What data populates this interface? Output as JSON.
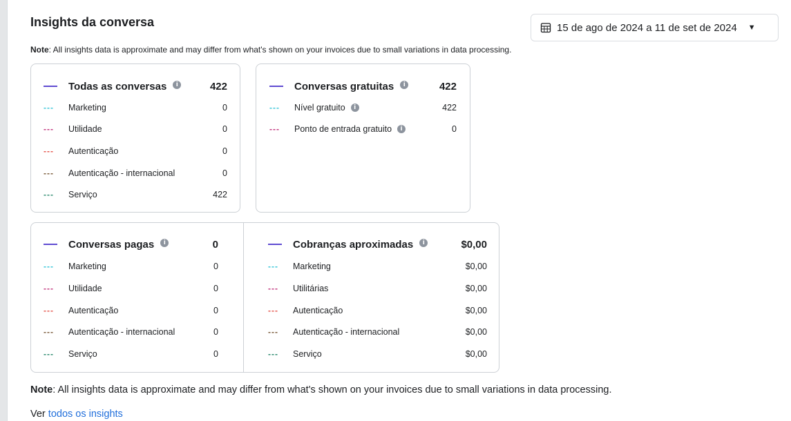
{
  "title": "Insights da conversa",
  "date_range": "15 de ago de 2024 a 11 de set de 2024",
  "note_label": "Note",
  "note_text": ": All insights data is approximate and may differ from what's shown on your invoices due to small variations in data processing.",
  "see_all_prefix": "Ver",
  "see_all_link": "todos os insights",
  "colors": {
    "marketing": "#36c5d8",
    "utilidade": "#c2367e",
    "autenticacao": "#e5544b",
    "internacional": "#7a5a3a",
    "servico": "#2a8a6d",
    "head": "#5e4ad1"
  },
  "cards": {
    "todas": {
      "title": "Todas as conversas",
      "total": "422",
      "rows": [
        {
          "label": "Marketing",
          "value": "0"
        },
        {
          "label": "Utilidade",
          "value": "0"
        },
        {
          "label": "Autenticação",
          "value": "0"
        },
        {
          "label": "Autenticação - internacional",
          "value": "0"
        },
        {
          "label": "Serviço",
          "value": "422"
        }
      ]
    },
    "gratuitas": {
      "title": "Conversas gratuitas",
      "total": "422",
      "rows": [
        {
          "label": "Nível gratuito",
          "value": "422"
        },
        {
          "label": "Ponto de entrada gratuito",
          "value": "0"
        }
      ]
    },
    "pagas": {
      "title": "Conversas pagas",
      "total": "0",
      "rows": [
        {
          "label": "Marketing",
          "value": "0"
        },
        {
          "label": "Utilidade",
          "value": "0"
        },
        {
          "label": "Autenticação",
          "value": "0"
        },
        {
          "label": "Autenticação - internacional",
          "value": "0"
        },
        {
          "label": "Serviço",
          "value": "0"
        }
      ]
    },
    "cobrancas": {
      "title": "Cobranças aproximadas",
      "total": "$0,00",
      "rows": [
        {
          "label": "Marketing",
          "value": "$0,00"
        },
        {
          "label": "Utilitárias",
          "value": "$0,00"
        },
        {
          "label": "Autenticação",
          "value": "$0,00"
        },
        {
          "label": "Autenticação - internacional",
          "value": "$0,00"
        },
        {
          "label": "Serviço",
          "value": "$0,00"
        }
      ]
    }
  }
}
